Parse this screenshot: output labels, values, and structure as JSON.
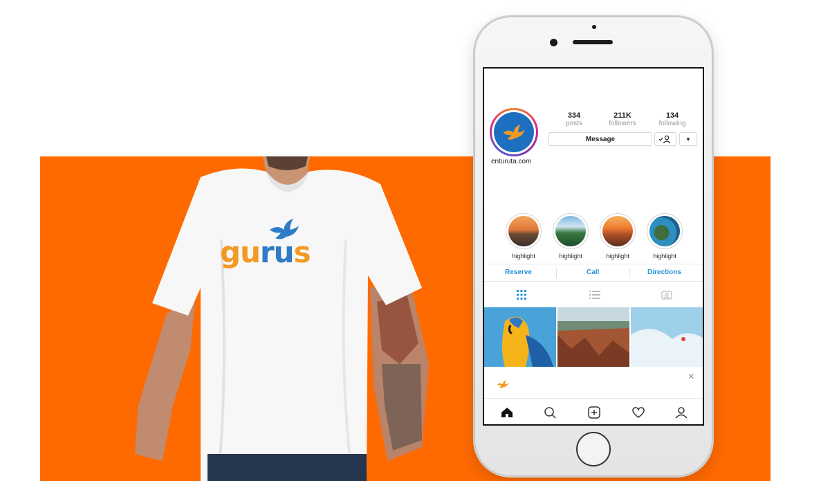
{
  "shirt_brand": {
    "text_part1": "gu",
    "text_part2": "ru",
    "text_part3": "s"
  },
  "profile": {
    "username": "enturuta.com",
    "stats": [
      {
        "value": "334",
        "label": "posts"
      },
      {
        "value": "211K",
        "label": "followers"
      },
      {
        "value": "134",
        "label": "following"
      }
    ],
    "message_label": "Message",
    "more_label": "▼"
  },
  "highlights": [
    {
      "label": "highlight"
    },
    {
      "label": "highlight"
    },
    {
      "label": "highlight"
    },
    {
      "label": "highlight"
    }
  ],
  "actions": {
    "reserve": "Reserve",
    "call": "Call",
    "directions": "Directions"
  },
  "notification": {
    "close": "×"
  },
  "colors": {
    "orange": "#ff6a00",
    "brand_blue": "#2f7cc6",
    "brand_orange": "#f39a23",
    "link_blue": "#2a93d8"
  }
}
